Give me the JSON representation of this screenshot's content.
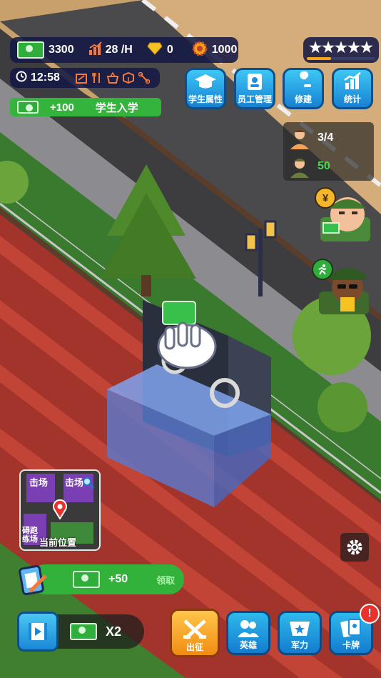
{
  "resources": {
    "cash": "3300",
    "income_rate": "28 /H",
    "gems": "0",
    "badges": "1000"
  },
  "stars": {
    "count": 5,
    "progress": 0.35
  },
  "clock": {
    "time": "12:58"
  },
  "event_banner": {
    "amount": "+100",
    "label": "学生入学"
  },
  "top_menu": [
    {
      "label": "学生属性",
      "icon": "graduation-cap-icon"
    },
    {
      "label": "员工管理",
      "icon": "id-badge-icon"
    },
    {
      "label": "修建",
      "icon": "wrench-icon"
    },
    {
      "label": "统计",
      "icon": "bar-chart-icon"
    }
  ],
  "staff_panel": {
    "students": "3/4",
    "soldiers": "50"
  },
  "minimap": {
    "tl": "击场",
    "tr": "击场",
    "bl": "碍跑练场",
    "location_label": "当前位置"
  },
  "reward_bar": {
    "amount": "+50",
    "claim_label": "领取"
  },
  "video_bonus": {
    "multiplier": "X2"
  },
  "bottom_nav": [
    {
      "label": "出征",
      "icon": "crossed-swords-icon"
    },
    {
      "label": "英雄",
      "icon": "people-icon"
    },
    {
      "label": "军力",
      "icon": "shield-star-icon"
    },
    {
      "label": "卡牌",
      "icon": "cards-icon"
    }
  ],
  "colors": {
    "hud_bg": "#141946",
    "green": "#2fae3c",
    "accent_orange": "#f6a316",
    "button_blue": "#1b8fde"
  }
}
